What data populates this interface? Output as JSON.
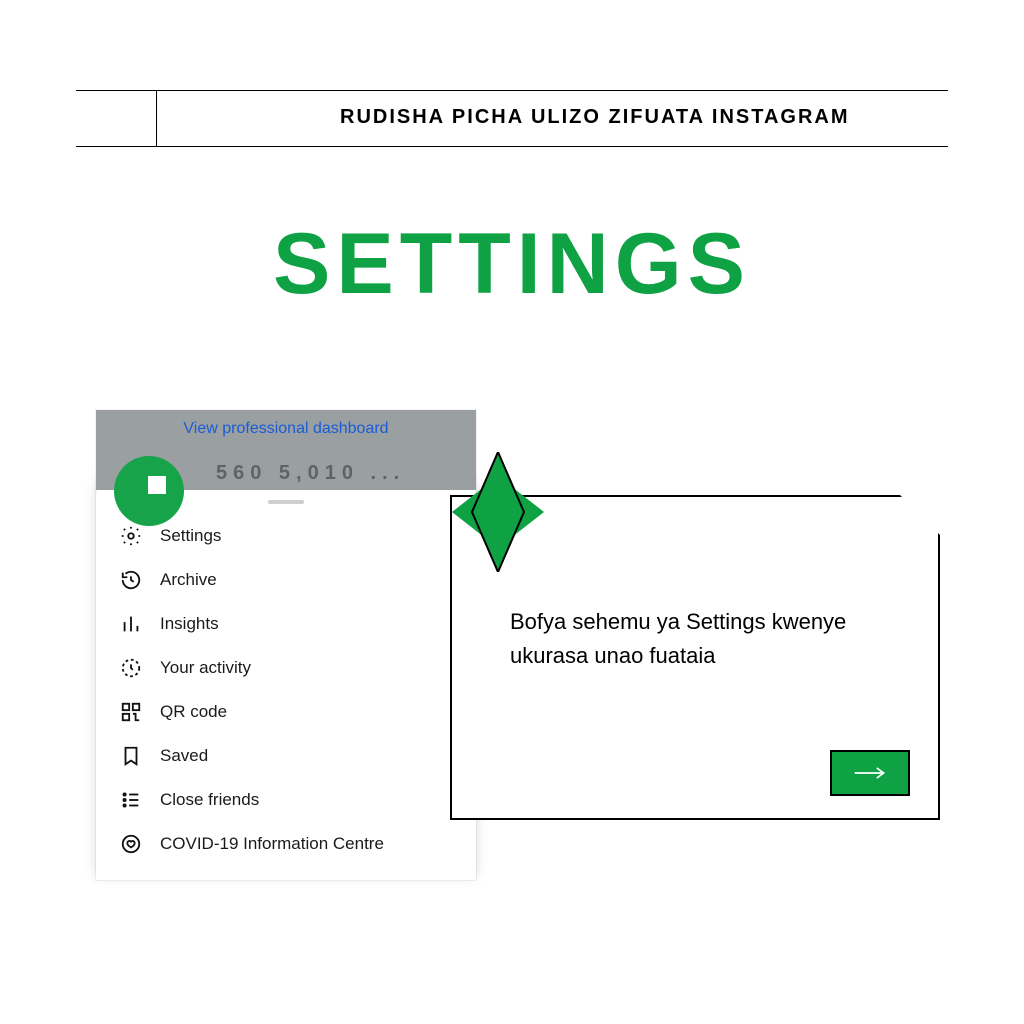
{
  "header": {
    "breadcrumb": "RUDISHA PICHA ULIZO ZIFUATA INSTAGRAM"
  },
  "title": "SETTINGS",
  "phone": {
    "dashboard_link": "View professional dashboard",
    "stats": "560    5,010    ...",
    "menu": [
      {
        "label": "Settings"
      },
      {
        "label": "Archive"
      },
      {
        "label": "Insights"
      },
      {
        "label": "Your activity"
      },
      {
        "label": "QR code"
      },
      {
        "label": "Saved"
      },
      {
        "label": "Close friends"
      },
      {
        "label": "COVID-19 Information Centre"
      }
    ]
  },
  "callout": {
    "text": "Bofya sehemu ya Settings kwenye ukurasa unao fuataia"
  }
}
